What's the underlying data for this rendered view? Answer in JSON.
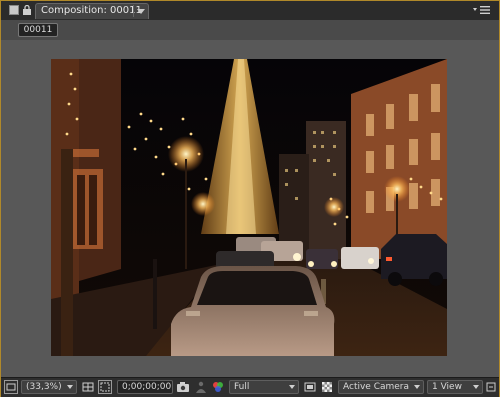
{
  "panel": {
    "tab_title": "Composition: 00011",
    "composition_name": "00011"
  },
  "toolbar": {
    "magnification": "(33,3%)",
    "timecode": "0;00;00;00",
    "resolution": "Full",
    "camera": "Active Camera",
    "view_layout": "1 View"
  },
  "colors": {
    "panel_border": "#b0892a",
    "viewer_bg": "#585858",
    "toolbar_bg": "#2e2e2e"
  }
}
